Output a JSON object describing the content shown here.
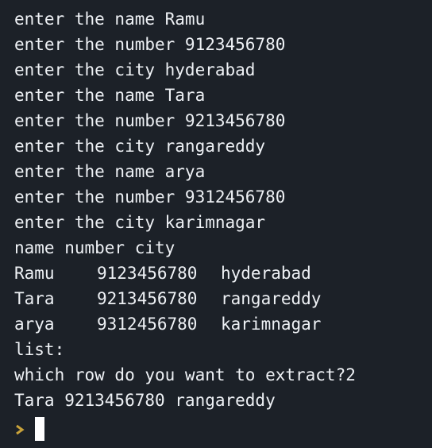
{
  "lines": [
    "enter the name Ramu",
    "enter the number 9123456780",
    "enter the city hyderabad",
    "enter the name Tara",
    "enter the number 9213456780",
    "enter the city rangareddy",
    "enter the name arya",
    "enter the number 9312456780",
    "enter the city karimnagar",
    "name number city"
  ],
  "table_rows": [
    [
      "Ramu",
      "9123456780",
      "hyderabad"
    ],
    [
      "Tara",
      "9213456780",
      "rangareddy"
    ],
    [
      "arya",
      "9312456780",
      "karimnagar"
    ]
  ],
  "after_lines": [
    "list:",
    "which row do you want to extract?2",
    "Tara 9213456780 rangareddy"
  ],
  "prompt": {
    "icon": "chevron-right-icon",
    "icon_color": "#c8a23a",
    "cursor_color": "#ffffff"
  }
}
